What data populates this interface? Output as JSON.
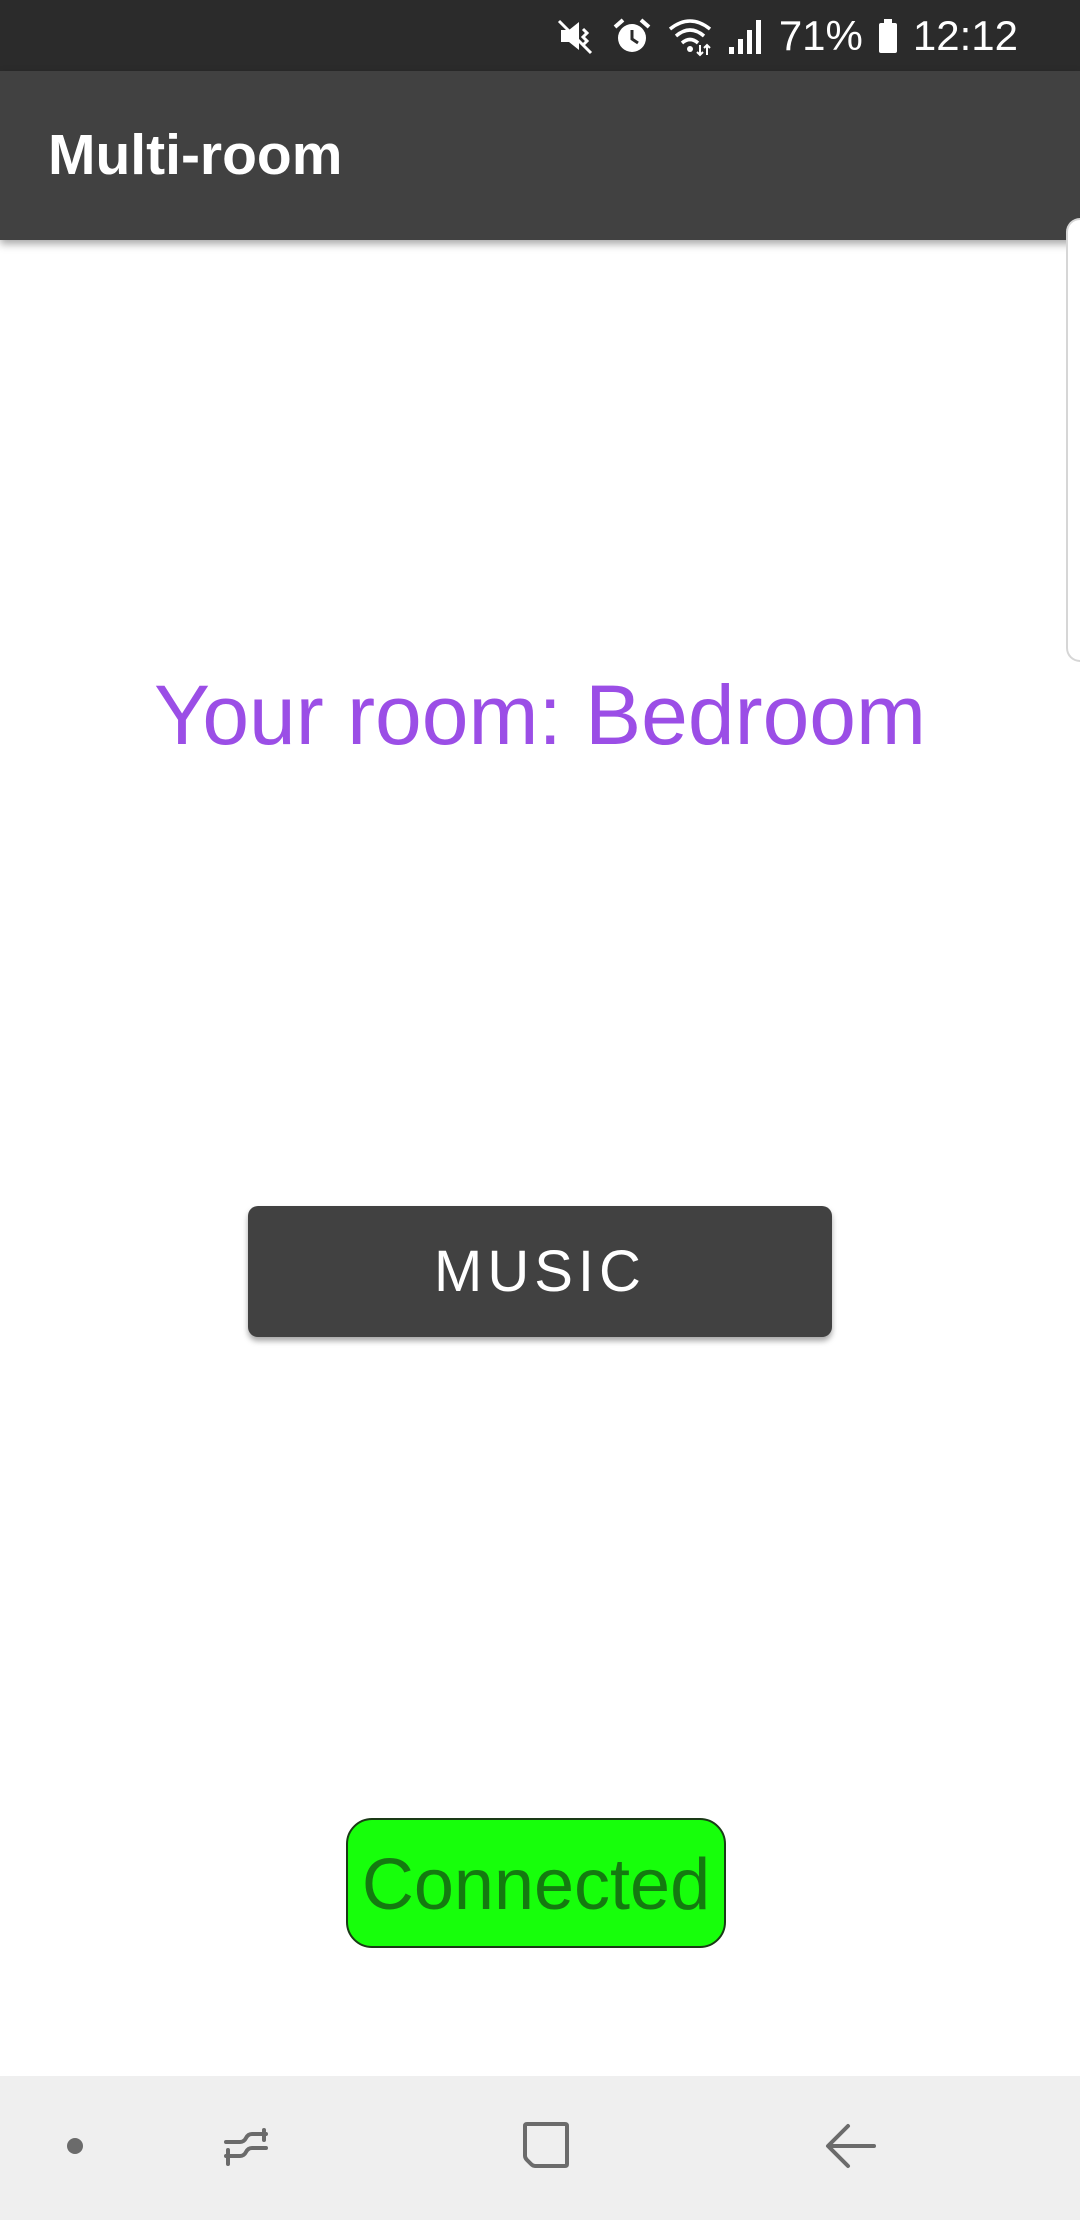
{
  "status_bar": {
    "battery_percent": "71%",
    "time": "12:12",
    "icons": [
      "mute-icon",
      "alarm-icon",
      "wifi-icon",
      "signal-icon",
      "battery-icon"
    ]
  },
  "app_bar": {
    "title": "Multi-room"
  },
  "main": {
    "room_label": "Your room: Bedroom",
    "music_button_label": "MUSIC",
    "connection_status": "Connected"
  },
  "nav_bar": {
    "icons": [
      "dot-icon",
      "recent-apps-icon",
      "home-icon",
      "back-icon"
    ]
  },
  "colors": {
    "status_bar_bg": "#2b2b2b",
    "app_bar_bg": "#414141",
    "room_label": "#9b4ee6",
    "connected_bg": "#17ff0b",
    "connected_text": "#147a10",
    "nav_bar_bg": "#efefef"
  }
}
